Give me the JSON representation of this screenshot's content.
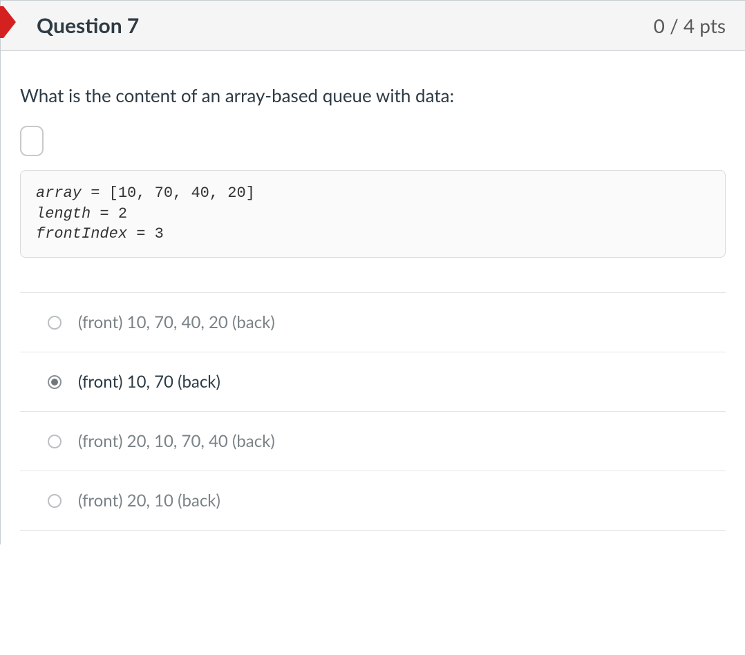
{
  "header": {
    "title": "Question 7",
    "points": "0 / 4 pts"
  },
  "prompt": "What is the content of an array-based queue with data:",
  "code": {
    "line1a": "array",
    "line1b": " = [10, 70, 40, 20]",
    "line2a": "length",
    "line2b": " = 2",
    "line3a": "frontIndex",
    "line3b": " = 3"
  },
  "answers": [
    {
      "label": "(front) 10, 70, 40, 20 (back)",
      "selected": false
    },
    {
      "label": "(front) 10, 70 (back)",
      "selected": true
    },
    {
      "label": "(front) 20, 10, 70, 40 (back)",
      "selected": false
    },
    {
      "label": "(front) 20, 10 (back)",
      "selected": false
    }
  ]
}
